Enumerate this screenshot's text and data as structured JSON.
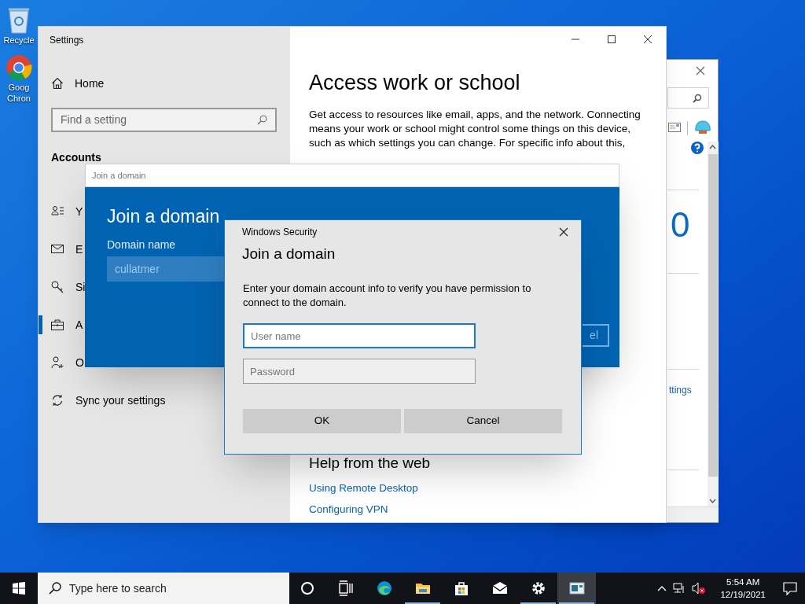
{
  "desktop_icons": [
    {
      "kind": "recycle-bin",
      "lines": [
        "Recycle"
      ]
    },
    {
      "kind": "browser",
      "lines": [
        "Goog",
        "Chron"
      ]
    }
  ],
  "background_window": {
    "big_text": "0",
    "link": "ttings"
  },
  "settings": {
    "title": "Settings",
    "home": "Home",
    "search_placeholder": "Find a setting",
    "section": "Accounts",
    "nav": [
      {
        "kind": "person-list",
        "label": "Y",
        "selected": false
      },
      {
        "kind": "mail",
        "label": "E",
        "selected": false
      },
      {
        "kind": "key",
        "label": "Si",
        "selected": false
      },
      {
        "kind": "briefcase",
        "label": "A",
        "selected": true
      },
      {
        "kind": "person-add",
        "label": "O",
        "selected": false
      },
      {
        "kind": "sync",
        "label": "Sync your settings",
        "selected": false
      }
    ],
    "page_title": "Access work or school",
    "intro": "Get access to resources like email, apps, and the network. Connecting means your work or school might control some things on this device, such as which settings you can change. For specific info about this,",
    "help_title": "Help from the web",
    "links": [
      "Using Remote Desktop",
      "Configuring VPN"
    ]
  },
  "join_dialog": {
    "title": "Join a domain",
    "heading": "Join a domain",
    "field_label": "Domain name",
    "field_value": "cullatmer",
    "button": "el"
  },
  "security_dialog": {
    "title": "Windows Security",
    "heading": "Join a domain",
    "message": "Enter your domain account info to verify you have permission to connect to the domain.",
    "fields": [
      {
        "placeholder": "User name",
        "focused": true
      },
      {
        "placeholder": "Password",
        "focused": false
      }
    ],
    "buttons": [
      "OK",
      "Cancel"
    ]
  },
  "taskbar": {
    "search_placeholder": "Type here to search",
    "apps": [
      {
        "kind": "cortana",
        "running": false,
        "selected": false
      },
      {
        "kind": "task-view",
        "running": false,
        "selected": false
      },
      {
        "kind": "edge",
        "running": false,
        "selected": false
      },
      {
        "kind": "folder",
        "running": true,
        "selected": false
      },
      {
        "kind": "store",
        "running": false,
        "selected": false
      },
      {
        "kind": "mail",
        "running": false,
        "selected": false
      },
      {
        "kind": "gear",
        "running": true,
        "selected": false
      },
      {
        "kind": "window-app",
        "running": true,
        "selected": true
      }
    ],
    "time": "5:54 AM",
    "date": "12/19/2021"
  }
}
